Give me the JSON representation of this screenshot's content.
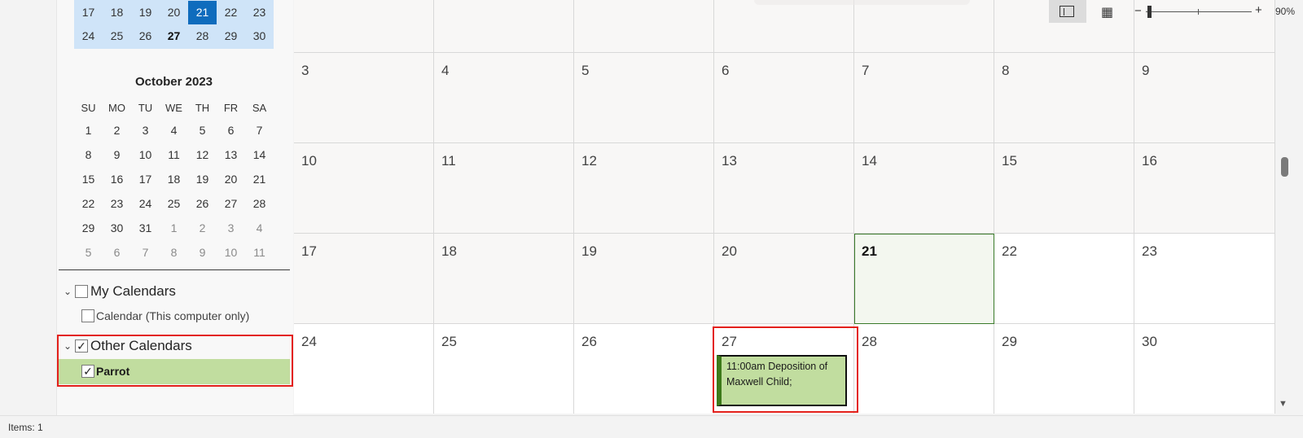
{
  "mini_calendar_prev": {
    "rows": [
      [
        "17",
        "18",
        "19",
        "20",
        "21",
        "22",
        "23"
      ],
      [
        "24",
        "25",
        "26",
        "27",
        "28",
        "29",
        "30"
      ]
    ],
    "selected": "21",
    "bold": "27"
  },
  "mini_calendar_oct": {
    "title": "October 2023",
    "weekdays": [
      "SU",
      "MO",
      "TU",
      "WE",
      "TH",
      "FR",
      "SA"
    ],
    "rows": [
      [
        "1",
        "2",
        "3",
        "4",
        "5",
        "6",
        "7"
      ],
      [
        "8",
        "9",
        "10",
        "11",
        "12",
        "13",
        "14"
      ],
      [
        "15",
        "16",
        "17",
        "18",
        "19",
        "20",
        "21"
      ],
      [
        "22",
        "23",
        "24",
        "25",
        "26",
        "27",
        "28"
      ],
      [
        "29",
        "30",
        "31",
        "1",
        "2",
        "3",
        "4"
      ],
      [
        "5",
        "6",
        "7",
        "8",
        "9",
        "10",
        "11"
      ]
    ]
  },
  "calendars": {
    "my_group": {
      "label": "My Calendars",
      "checked": false
    },
    "my_items": [
      {
        "label": "Calendar (This computer only)",
        "checked": false
      }
    ],
    "other_group": {
      "label": "Other Calendars",
      "checked": true
    },
    "other_items": [
      {
        "label": "Parrot",
        "checked": true
      }
    ]
  },
  "month": {
    "weeks": [
      [
        "",
        "",
        "",
        "",
        "",
        "",
        ""
      ],
      [
        "3",
        "4",
        "5",
        "6",
        "7",
        "8",
        "9"
      ],
      [
        "10",
        "11",
        "12",
        "13",
        "14",
        "15",
        "16"
      ],
      [
        "17",
        "18",
        "19",
        "20",
        "21",
        "22",
        "23"
      ],
      [
        "24",
        "25",
        "26",
        "27",
        "28",
        "29",
        "30"
      ]
    ],
    "today": "21",
    "event": {
      "day": "27",
      "text": "11:00am Deposition of Maxwell Child;"
    }
  },
  "status": {
    "items": "Items: 1",
    "zoom": "90%"
  },
  "icons": {
    "chevron": "chevron-down-icon",
    "check": "✓",
    "scroll_down": "▼",
    "zoom_minus": "−",
    "zoom_plus": "+",
    "reading_view": "📖"
  },
  "colors": {
    "selected_day": "#0f6cbd",
    "mini_highlight": "#cfe4f8",
    "parrot_color": "#c1dd9f",
    "highlight_red": "#e3201b"
  }
}
